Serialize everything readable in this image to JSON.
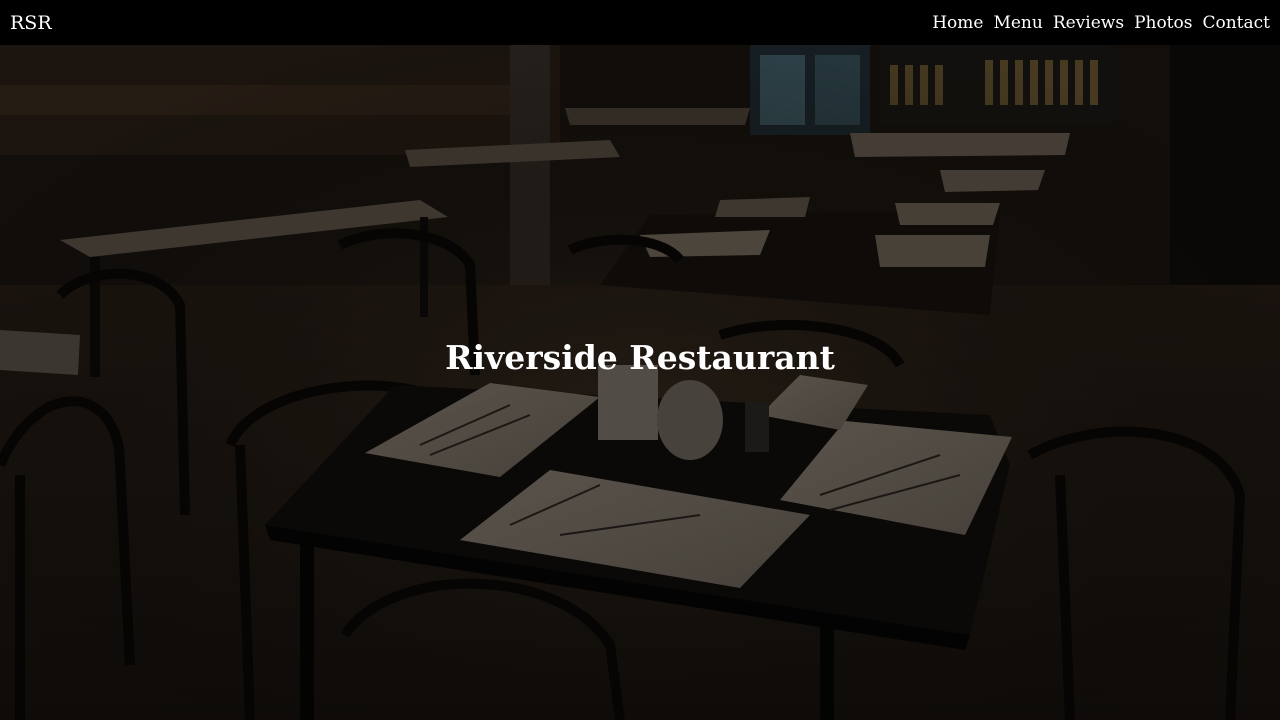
{
  "navbar": {
    "brand": "RSR",
    "links": [
      "Home",
      "Menu",
      "Reviews",
      "Photos",
      "Contact"
    ]
  },
  "hero": {
    "title": "Riverside Restaurant"
  },
  "colors": {
    "navbar_bg": "#000000",
    "text": "#ffffff"
  }
}
